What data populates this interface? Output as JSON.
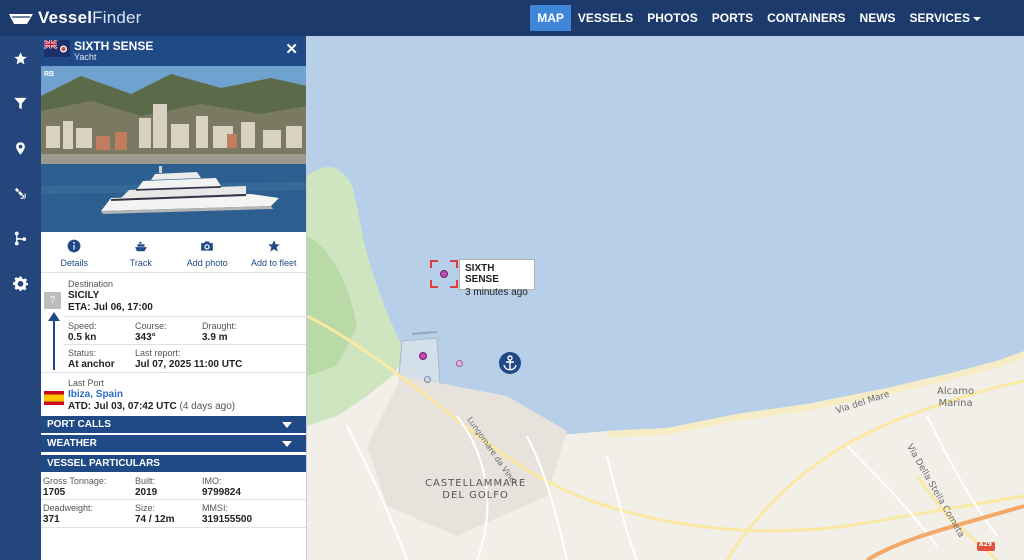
{
  "app": {
    "logo_bold": "Vessel",
    "logo_rest": "Finder"
  },
  "nav": {
    "items": [
      {
        "label": "MAP",
        "active": true
      },
      {
        "label": "VESSELS"
      },
      {
        "label": "PHOTOS"
      },
      {
        "label": "PORTS"
      },
      {
        "label": "CONTAINERS"
      },
      {
        "label": "NEWS"
      },
      {
        "label": "SERVICES"
      }
    ]
  },
  "rail": {
    "icons": [
      "star-icon",
      "filter-icon",
      "location-pin-icon",
      "satellite-icon",
      "route-icon",
      "gear-icon"
    ]
  },
  "vessel": {
    "name": "SIXTH SENSE",
    "type": "Yacht",
    "flag": "cayman-islands-flag",
    "photo_watermark": "RB",
    "actions": {
      "details": "Details",
      "track": "Track",
      "add_photo": "Add photo",
      "add_to_fleet": "Add to fleet"
    },
    "destination": {
      "label": "Destination",
      "value": "SICILY",
      "eta": "ETA: Jul 06, 17:00",
      "unknown_port": "?"
    },
    "speed": {
      "label": "Speed:",
      "value": "0.5 kn"
    },
    "course": {
      "label": "Course:",
      "value": "343°"
    },
    "draught": {
      "label": "Draught:",
      "value": "3.9 m"
    },
    "status": {
      "label": "Status:",
      "value": "At anchor"
    },
    "last_report": {
      "label": "Last report:",
      "value": "Jul 07, 2025 11:00 UTC"
    },
    "last_port": {
      "label": "Last Port",
      "value": "Ibiza, Spain",
      "atd": "ATD: Jul 03, 07:42 UTC",
      "ago": "(4 days ago)",
      "flag": "spain-flag"
    },
    "sections": {
      "port_calls": "PORT CALLS",
      "weather": "WEATHER",
      "particulars": "VESSEL PARTICULARS"
    },
    "particulars": {
      "gross_tonnage": {
        "label": "Gross Tonnage:",
        "value": "1705"
      },
      "built": {
        "label": "Built:",
        "value": "2019"
      },
      "imo": {
        "label": "IMO:",
        "value": "9799824"
      },
      "deadweight": {
        "label": "Deadweight:",
        "value": "371"
      },
      "size": {
        "label": "Size:",
        "value": "74 / 12m"
      },
      "mmsi": {
        "label": "MMSI:",
        "value": "319155500"
      }
    }
  },
  "map": {
    "tooltip": {
      "name": "SIXTH SENSE",
      "time": "3 minutes ago"
    },
    "labels": {
      "town_line1": "CASTELLAMMARE",
      "town_line2": "DEL GOLFO",
      "alcamo_line1": "Alcamo",
      "alcamo_line2": "Marina",
      "road1": "Via del Mare",
      "road2": "Via Della Stella Cometa",
      "road3": "Lungomare da Vinci",
      "motorway": "A29"
    },
    "colors": {
      "sea": "#b7cfe9",
      "land": "#f2efe9",
      "vessel": "#c24ab8",
      "accent": "#1f4a86"
    }
  }
}
